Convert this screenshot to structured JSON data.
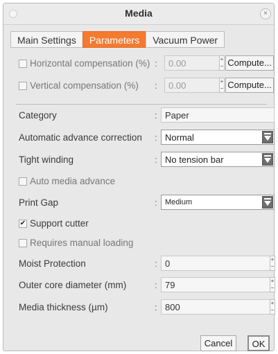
{
  "window": {
    "title": "Media"
  },
  "tabs": [
    {
      "label": "Main Settings",
      "active": false
    },
    {
      "label": "Parameters",
      "active": true
    },
    {
      "label": "Vacuum Power",
      "active": false
    }
  ],
  "compensation": {
    "horizontal": {
      "label": "Horizontal compensation (%)",
      "checked": false,
      "value": "0.00",
      "compute_label": "Compute..."
    },
    "vertical": {
      "label": "Vertical compensation (%)",
      "checked": false,
      "value": "0.00",
      "compute_label": "Compute..."
    }
  },
  "colon": ":",
  "fields": {
    "category": {
      "label": "Category",
      "value": "Paper"
    },
    "auto_advance_correction": {
      "label": "Automatic advance correction",
      "value": "Normal"
    },
    "tight_winding": {
      "label": "Tight winding",
      "value": "No tension bar"
    },
    "auto_media_advance": {
      "label": "Auto media advance",
      "checked": false
    },
    "print_gap": {
      "label": "Print Gap",
      "value": "Medium"
    },
    "support_cutter": {
      "label": "Support cutter",
      "checked": true
    },
    "requires_manual_loading": {
      "label": "Requires manual loading",
      "checked": false
    },
    "moist_protection": {
      "label": "Moist Protection",
      "value": "0"
    },
    "outer_core_diameter": {
      "label": "Outer core diameter (mm)",
      "value": "79"
    },
    "media_thickness": {
      "label": "Media thickness (µm)",
      "value": "800"
    }
  },
  "footer": {
    "cancel_label": "Cancel",
    "ok_label": "OK"
  },
  "icons": {
    "check": "✔",
    "close": "×",
    "spin_up": "+",
    "spin_down": "−"
  },
  "colors": {
    "accent": "#f47a30",
    "window_bg": "#e8e8e8",
    "dropdown_button": "#6e6e6e"
  }
}
